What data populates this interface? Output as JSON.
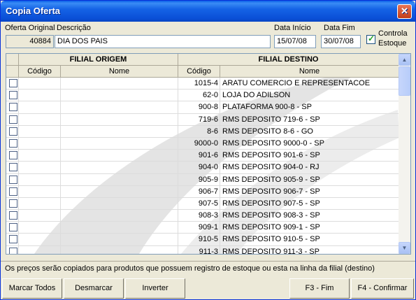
{
  "window": {
    "title": "Copia Oferta",
    "close_glyph": "✕"
  },
  "form": {
    "oferta_original_label": "Oferta Original",
    "descricao_label": "Descrição",
    "data_inicio_label": "Data Início",
    "data_fim_label": "Data Fim",
    "controla_estoque_label_1": "Controla",
    "controla_estoque_label_2": "Estoque",
    "oferta_original_value": "40884",
    "descricao_value": "DIA DOS PAIS",
    "data_inicio_value": "15/07/08",
    "data_fim_value": "30/07/08",
    "controla_estoque_checked": true
  },
  "grid": {
    "group_headers": [
      "FILIAL ORIGEM",
      "FILIAL DESTINO"
    ],
    "columns": [
      "Código",
      "Nome",
      "Código",
      "Nome"
    ],
    "rows": [
      {
        "codigo": "1015-4",
        "nome": "ARATU COMERCIO E REPRESENTACOE"
      },
      {
        "codigo": "62-0",
        "nome": "LOJA DO ADILSON"
      },
      {
        "codigo": "900-8",
        "nome": "PLATAFORMA 900-8 - SP"
      },
      {
        "codigo": "719-6",
        "nome": "RMS DEPOSITO 719-6 - SP"
      },
      {
        "codigo": "8-6",
        "nome": "RMS DEPOSITO 8-6 - GO"
      },
      {
        "codigo": "9000-0",
        "nome": "RMS DEPOSITO 9000-0 - SP"
      },
      {
        "codigo": "901-6",
        "nome": "RMS DEPOSITO 901-6 - SP"
      },
      {
        "codigo": "904-0",
        "nome": "RMS DEPOSITO 904-0 - RJ"
      },
      {
        "codigo": "905-9",
        "nome": "RMS DEPOSITO 905-9 - SP"
      },
      {
        "codigo": "906-7",
        "nome": "RMS DEPOSITO 906-7 - SP"
      },
      {
        "codigo": "907-5",
        "nome": "RMS DEPOSITO 907-5 - SP"
      },
      {
        "codigo": "908-3",
        "nome": "RMS DEPOSITO 908-3 - SP"
      },
      {
        "codigo": "909-1",
        "nome": "RMS DEPOSITO 909-1 - SP"
      },
      {
        "codigo": "910-5",
        "nome": "RMS DEPOSITO 910-5 - SP"
      },
      {
        "codigo": "911-3",
        "nome": "RMS DEPOSITO 911-3 - SP"
      }
    ],
    "scroll_up_glyph": "▲",
    "scroll_down_glyph": "▼"
  },
  "status_text": "Os preços serão copiados para produtos que possuem registro de estoque ou esta na linha da filial (destino)",
  "buttons": {
    "marcar_todos": "Marcar Todos",
    "desmarcar": "Desmarcar",
    "inverter": "Inverter",
    "fim": "F3 - Fim",
    "confirmar": "F4 - Confirmar"
  },
  "colors": {
    "titlebar": "#0a4fd6",
    "window_bg": "#ece9d8",
    "field_border": "#7f9db9"
  }
}
